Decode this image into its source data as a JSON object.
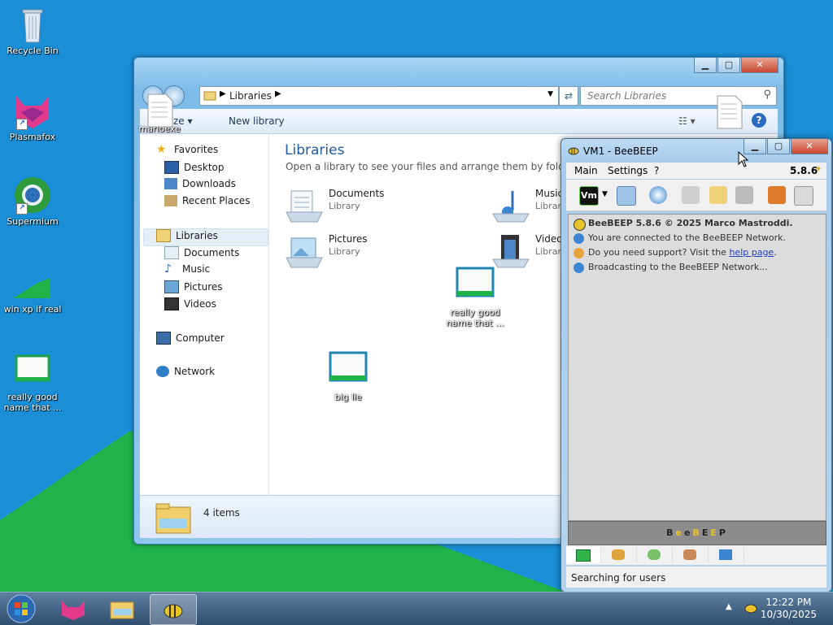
{
  "desktop": {
    "icons": [
      {
        "label": "Recycle Bin"
      },
      {
        "label": "Plasmafox"
      },
      {
        "label": "Supermium"
      },
      {
        "label": "win xp if real"
      },
      {
        "label": "really good name that ..."
      },
      {
        "label": "really good name that ..."
      },
      {
        "label": "big lie"
      },
      {
        "label": "marioexe"
      }
    ]
  },
  "explorer": {
    "address": "Libraries",
    "search_placeholder": "Search Libraries",
    "toolbar": {
      "organize": "nize",
      "new_library": "New library"
    },
    "nav": {
      "favorites": "Favorites",
      "desktop": "Desktop",
      "downloads": "Downloads",
      "recent": "Recent Places",
      "libraries": "Libraries",
      "documents": "Documents",
      "music": "Music",
      "pictures": "Pictures",
      "videos": "Videos",
      "computer": "Computer",
      "network": "Network"
    },
    "main": {
      "title": "Libraries",
      "subtitle": "Open a library to see your files and arrange them by folder, date,",
      "items": [
        {
          "name": "Documents",
          "type": "Library"
        },
        {
          "name": "Music",
          "type": "Librar"
        },
        {
          "name": "Pictures",
          "type": "Library"
        },
        {
          "name": "Videos",
          "type": "Librar"
        }
      ]
    },
    "status": {
      "count": "4 items"
    },
    "colors": {
      "title": "#1e5aa0",
      "frame": "#8ec6ee"
    }
  },
  "beebeep": {
    "title": "VM1 - BeeBEEP",
    "menu": {
      "main": "Main",
      "settings": "Settings",
      "help": "?",
      "version": "5.8.6"
    },
    "vm_badge": "Vm",
    "log": [
      {
        "text": "BeeBEEP 5.8.6 © 2025 Marco Mastroddi."
      },
      {
        "text": "You are connected to the BeeBEEP Network."
      },
      {
        "text": "Do you need support? Visit the ",
        "link": "help page",
        "suffix": "."
      },
      {
        "text": "Broadcasting to the BeeBEEP Network..."
      }
    ],
    "banner": [
      "B",
      "e",
      "e",
      "B",
      "E",
      "E",
      "P"
    ],
    "status": "Searching for users"
  },
  "taskbar": {
    "time": "12:22 PM",
    "date": "10/30/2025"
  }
}
